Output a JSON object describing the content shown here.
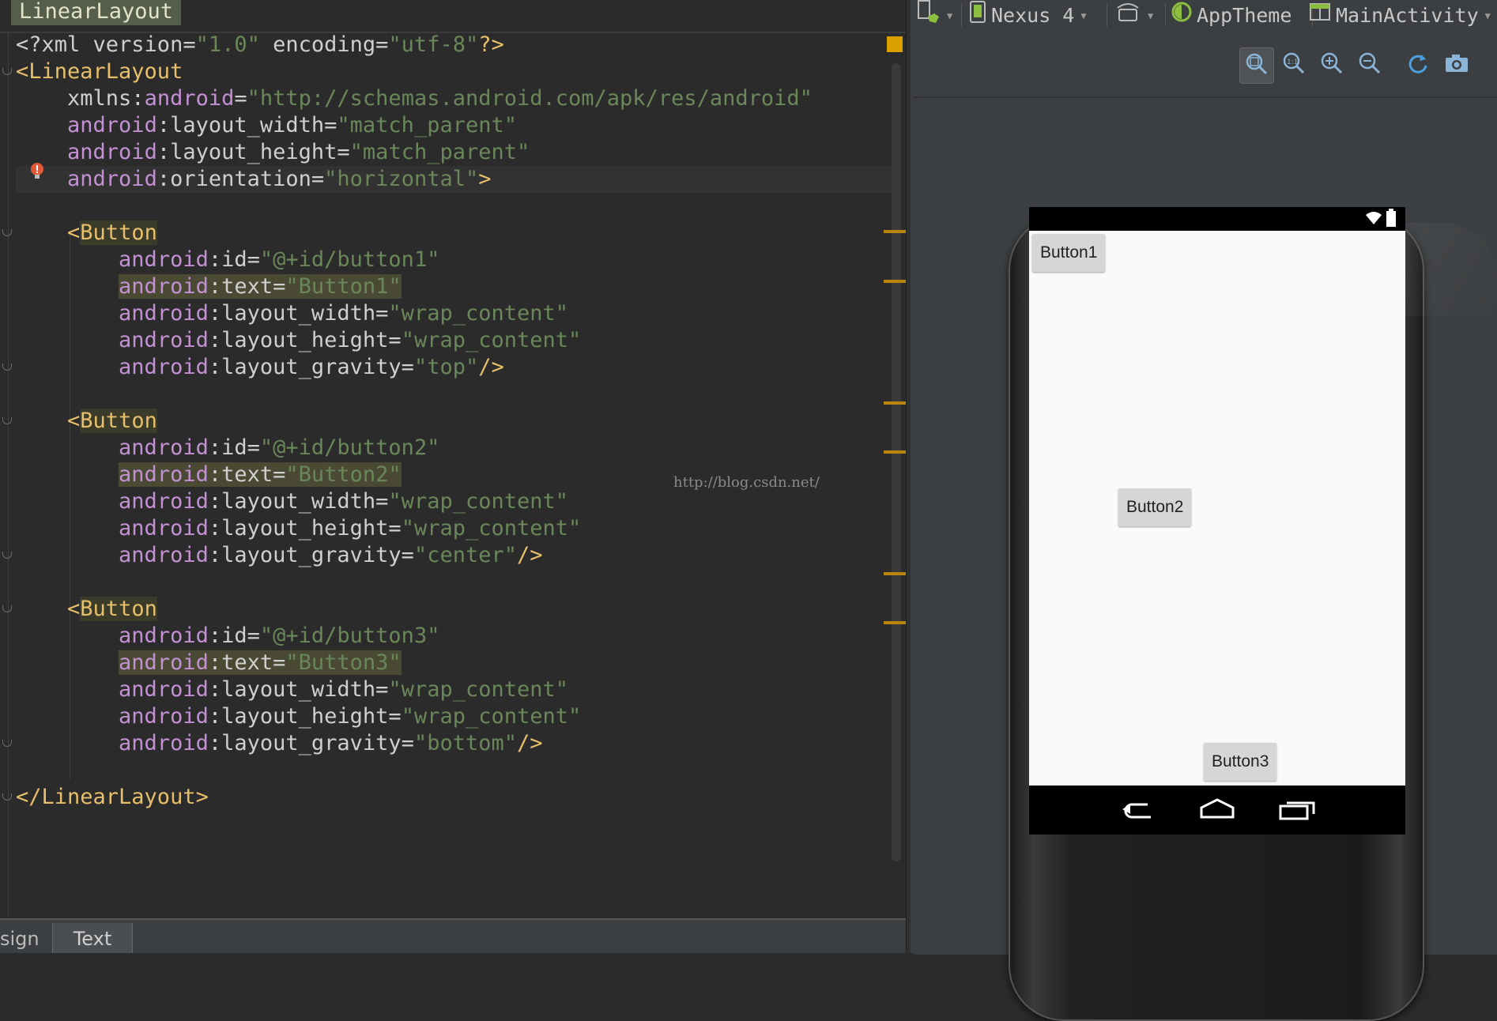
{
  "editor": {
    "breadcrumb": "LinearLayout",
    "lines": [
      [
        [
          "t-plain",
          "<?xml version="
        ],
        [
          "t-str",
          "\"1.0\""
        ],
        [
          "t-plain",
          " encoding="
        ],
        [
          "t-str",
          "\"utf-8\""
        ],
        [
          "t-tag",
          "?>"
        ]
      ],
      [
        [
          "t-tag",
          "<LinearLayout"
        ]
      ],
      [
        [
          "t-plain",
          "    xmlns:"
        ],
        [
          "t-ns",
          "android"
        ],
        [
          "t-plain",
          "="
        ],
        [
          "t-str",
          "\"http://schemas.android.com/apk/res/android\""
        ]
      ],
      [
        [
          "t-plain",
          "    "
        ],
        [
          "t-ns",
          "android"
        ],
        [
          "t-plain",
          ":layout_width="
        ],
        [
          "t-str",
          "\"match_parent\""
        ]
      ],
      [
        [
          "t-plain",
          "    "
        ],
        [
          "t-ns",
          "android"
        ],
        [
          "t-plain",
          ":layout_height="
        ],
        [
          "t-str",
          "\"match_parent\""
        ]
      ],
      [
        [
          "t-plain",
          "    "
        ],
        [
          "t-ns",
          "android"
        ],
        [
          "t-plain",
          ":orientation="
        ],
        [
          "t-str",
          "\"horizontal\""
        ],
        [
          "t-tag",
          ">"
        ]
      ],
      [],
      [
        [
          "t-plain",
          "    "
        ],
        [
          "t-tag",
          "<"
        ],
        [
          "t-tagname-hl",
          "Button"
        ]
      ],
      [
        [
          "t-plain",
          "        "
        ],
        [
          "t-ns",
          "android"
        ],
        [
          "t-plain",
          ":id="
        ],
        [
          "t-str",
          "\"@+id/button1\""
        ]
      ],
      [
        [
          "t-plain",
          "        "
        ],
        [
          "t-ns t-hl",
          "android"
        ],
        [
          "t-plain t-hl",
          ":text="
        ],
        [
          "t-str t-hl",
          "\"Button1\""
        ]
      ],
      [
        [
          "t-plain",
          "        "
        ],
        [
          "t-ns",
          "android"
        ],
        [
          "t-plain",
          ":layout_width="
        ],
        [
          "t-str",
          "\"wrap_content\""
        ]
      ],
      [
        [
          "t-plain",
          "        "
        ],
        [
          "t-ns",
          "android"
        ],
        [
          "t-plain",
          ":layout_height="
        ],
        [
          "t-str",
          "\"wrap_content\""
        ]
      ],
      [
        [
          "t-plain",
          "        "
        ],
        [
          "t-ns",
          "android"
        ],
        [
          "t-plain",
          ":layout_gravity="
        ],
        [
          "t-str",
          "\"top\""
        ],
        [
          "t-tag",
          "/>"
        ]
      ],
      [],
      [
        [
          "t-plain",
          "    "
        ],
        [
          "t-tag",
          "<"
        ],
        [
          "t-tagname-hl",
          "Button"
        ]
      ],
      [
        [
          "t-plain",
          "        "
        ],
        [
          "t-ns",
          "android"
        ],
        [
          "t-plain",
          ":id="
        ],
        [
          "t-str",
          "\"@+id/button2\""
        ]
      ],
      [
        [
          "t-plain",
          "        "
        ],
        [
          "t-ns t-hl",
          "android"
        ],
        [
          "t-plain t-hl",
          ":text="
        ],
        [
          "t-str t-hl",
          "\"Button2\""
        ]
      ],
      [
        [
          "t-plain",
          "        "
        ],
        [
          "t-ns",
          "android"
        ],
        [
          "t-plain",
          ":layout_width="
        ],
        [
          "t-str",
          "\"wrap_content\""
        ]
      ],
      [
        [
          "t-plain",
          "        "
        ],
        [
          "t-ns",
          "android"
        ],
        [
          "t-plain",
          ":layout_height="
        ],
        [
          "t-str",
          "\"wrap_content\""
        ]
      ],
      [
        [
          "t-plain",
          "        "
        ],
        [
          "t-ns",
          "android"
        ],
        [
          "t-plain",
          ":layout_gravity="
        ],
        [
          "t-str",
          "\"center\""
        ],
        [
          "t-tag",
          "/>"
        ]
      ],
      [],
      [
        [
          "t-plain",
          "    "
        ],
        [
          "t-tag",
          "<"
        ],
        [
          "t-tagname-hl",
          "Button"
        ]
      ],
      [
        [
          "t-plain",
          "        "
        ],
        [
          "t-ns",
          "android"
        ],
        [
          "t-plain",
          ":id="
        ],
        [
          "t-str",
          "\"@+id/button3\""
        ]
      ],
      [
        [
          "t-plain",
          "        "
        ],
        [
          "t-ns t-hl",
          "android"
        ],
        [
          "t-plain t-hl",
          ":text="
        ],
        [
          "t-str t-hl",
          "\"Button3\""
        ]
      ],
      [
        [
          "t-plain",
          "        "
        ],
        [
          "t-ns",
          "android"
        ],
        [
          "t-plain",
          ":layout_width="
        ],
        [
          "t-str",
          "\"wrap_content\""
        ]
      ],
      [
        [
          "t-plain",
          "        "
        ],
        [
          "t-ns",
          "android"
        ],
        [
          "t-plain",
          ":layout_height="
        ],
        [
          "t-str",
          "\"wrap_content\""
        ]
      ],
      [
        [
          "t-plain",
          "        "
        ],
        [
          "t-ns",
          "android"
        ],
        [
          "t-plain",
          ":layout_gravity="
        ],
        [
          "t-str",
          "\"bottom\""
        ],
        [
          "t-tag",
          "/>"
        ]
      ],
      [],
      [
        [
          "t-tag",
          "</LinearLayout>"
        ]
      ]
    ],
    "watermark": "http://blog.csdn.net/",
    "tabs": {
      "design": "sign",
      "text": "Text"
    }
  },
  "preview": {
    "toolbar": {
      "device": "Nexus 4",
      "theme": "AppTheme",
      "activity": "MainActivity"
    },
    "buttons": {
      "button1": "Button1",
      "button2": "Button2",
      "button3": "Button3"
    }
  },
  "colors": {
    "tag": "#e8bf6a",
    "attr_ns": "#c390d4",
    "string": "#6a8759",
    "plain": "#cfcfcf",
    "editor_bg": "#2b2b2b",
    "panel_bg": "#3c3f41"
  }
}
